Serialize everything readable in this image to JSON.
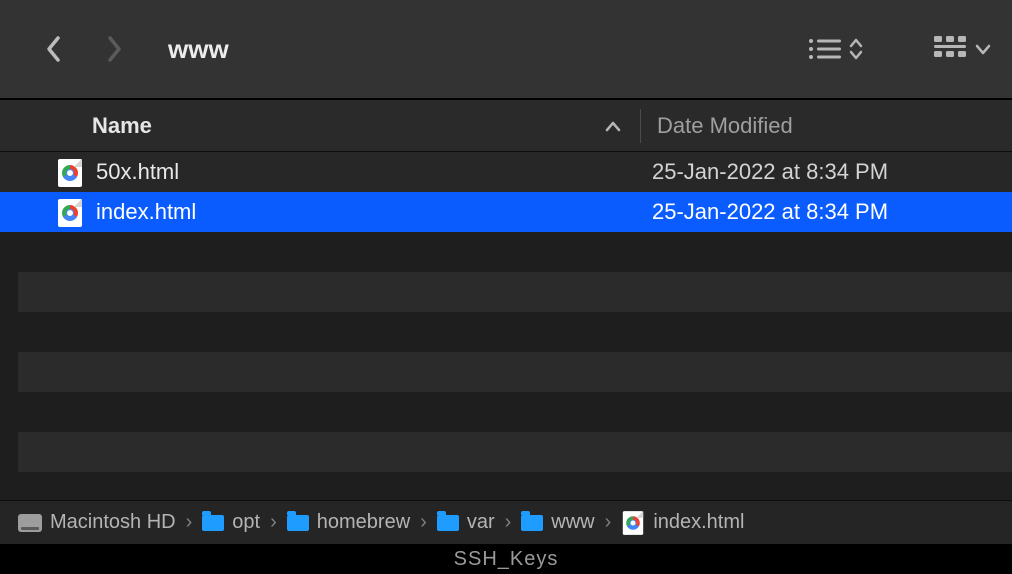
{
  "toolbar": {
    "title": "www"
  },
  "columns": {
    "name": "Name",
    "date": "Date Modified"
  },
  "files": [
    {
      "name": "50x.html",
      "date": "25-Jan-2022 at 8:34 PM",
      "selected": false
    },
    {
      "name": "index.html",
      "date": "25-Jan-2022 at 8:34 PM",
      "selected": true
    }
  ],
  "path": {
    "disk": "Macintosh HD",
    "segments": [
      {
        "label": "opt",
        "color": "#1e9cff"
      },
      {
        "label": "homebrew",
        "color": "#1e9cff"
      },
      {
        "label": "var",
        "color": "#1e9cff"
      },
      {
        "label": "www",
        "color": "#1e9cff"
      }
    ],
    "file": "index.html"
  },
  "under_hint": "SSH_Keys"
}
